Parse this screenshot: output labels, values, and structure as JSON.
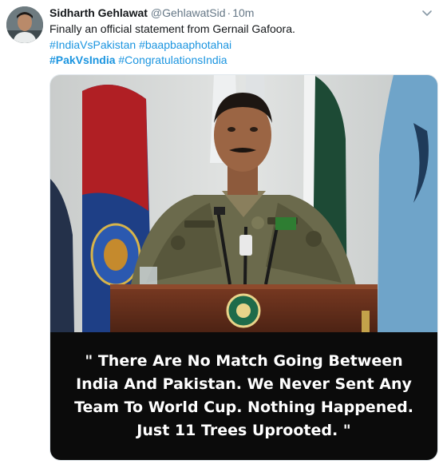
{
  "tweet": {
    "author_name": "Sidharth Gehlawat",
    "author_handle": "@GehlawatSid",
    "separator": "·",
    "time": "10m",
    "text_line1": "Finally an official statement from Gernail Gafoora.",
    "hashtags_line2": [
      "#IndiaVsPakistan",
      "#baapbaaphotahai"
    ],
    "hashtags_line3": [
      "#PakVsIndia",
      "#CongratulationsIndia"
    ]
  },
  "media": {
    "caption_lines": [
      "\" There Are No Match Going Between",
      "India And Pakistan. We Never Sent Any",
      "Team To World Cup. Nothing Happened.",
      "Just 11 Trees Uprooted. \""
    ]
  },
  "icons": {
    "avatar": "user-avatar",
    "menu": "chevron-down-icon"
  },
  "colors": {
    "link": "#1b95e0",
    "name": "#14171a",
    "muted": "#657786",
    "caption_bg": "#0b0b0b"
  }
}
